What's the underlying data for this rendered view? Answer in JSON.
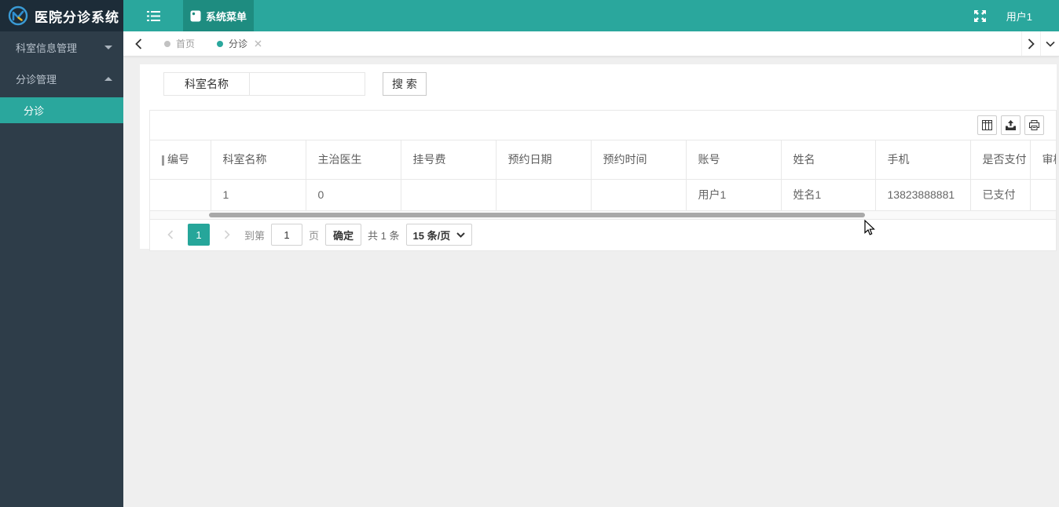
{
  "app": {
    "title": "医院分诊系统",
    "user": "用户1"
  },
  "topbar": {
    "menu_tab": "系统菜单"
  },
  "sidebar": {
    "items": [
      {
        "label": "科室信息管理",
        "state": "collapsed"
      },
      {
        "label": "分诊管理",
        "state": "expanded",
        "children": [
          {
            "label": "分诊",
            "active": true
          }
        ]
      }
    ]
  },
  "tabs": [
    {
      "label": "首页",
      "active": false
    },
    {
      "label": "分诊",
      "active": true,
      "closable": true
    }
  ],
  "search": {
    "label": "科室名称",
    "value": "",
    "button": "搜 索"
  },
  "table": {
    "toolbar_icons": [
      "columns-icon",
      "export-icon",
      "print-icon"
    ],
    "columns": [
      "编号",
      "科室名称",
      "主治医生",
      "挂号费",
      "预约日期",
      "预约时间",
      "账号",
      "姓名",
      "手机",
      "是否支付",
      "审核"
    ],
    "rows": [
      [
        "",
        "1",
        "0",
        "",
        "",
        "",
        "用户1",
        "姓名1",
        "13823888881",
        "已支付",
        ""
      ]
    ]
  },
  "pagination": {
    "current": "1",
    "goto_label": "到第",
    "page_value": "1",
    "page_unit": "页",
    "confirm_label": "确定",
    "total_label": "共 1 条",
    "page_size": "15 条/页"
  },
  "colors": {
    "accent": "#2AA79D",
    "accent_dark": "#1E8C80",
    "sidebar_bg": "#2E3D49",
    "logo_bg": "#1D2C38",
    "page_bg": "#EFEFEF",
    "pagination_active": "#26A69A",
    "scrollbar_thumb": "#A9A9A9"
  }
}
